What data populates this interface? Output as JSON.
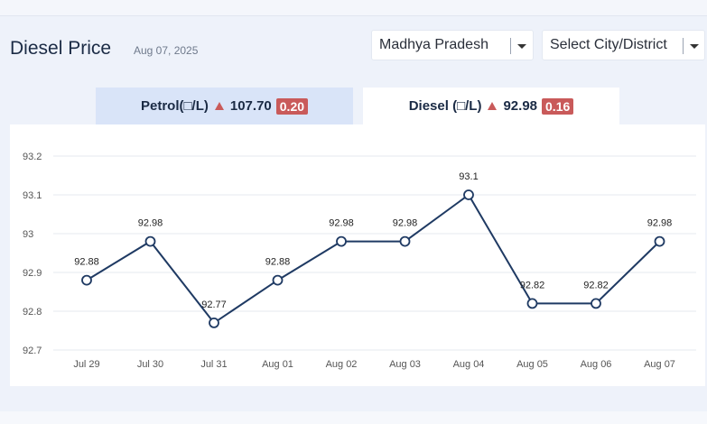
{
  "header": {
    "title": "Diesel Price",
    "date": "Aug 07, 2025"
  },
  "filters": {
    "state": "Madhya Pradesh",
    "city_placeholder": "Select City/District"
  },
  "tabs": [
    {
      "label": "Petrol(□/L)",
      "price": "107.70",
      "change": "0.20",
      "trend": "up",
      "selected": false
    },
    {
      "label": "Diesel (□/L)",
      "price": "92.98",
      "change": "0.16",
      "trend": "up",
      "selected": true
    }
  ],
  "colors": {
    "line": "#1f3a63",
    "badge": "#c95a5a",
    "grid": "#e6e9ef"
  },
  "chart_data": {
    "type": "line",
    "categories": [
      "Jul 29",
      "Jul 30",
      "Jul 31",
      "Aug 01",
      "Aug 02",
      "Aug 03",
      "Aug 04",
      "Aug 05",
      "Aug 06",
      "Aug 07"
    ],
    "values": [
      92.88,
      92.98,
      92.77,
      92.88,
      92.98,
      92.98,
      93.1,
      92.82,
      92.82,
      92.98
    ],
    "data_labels": [
      "92.88",
      "92.98",
      "92.77",
      "92.88",
      "92.98",
      "92.98",
      "93.1",
      "92.82",
      "92.82",
      "92.98"
    ],
    "y_ticks": [
      "93.2",
      "93.1",
      "93",
      "92.9",
      "92.8",
      "92.7"
    ],
    "ylim": [
      92.7,
      93.2
    ],
    "grid": true,
    "title": "",
    "xlabel": "",
    "ylabel": ""
  }
}
